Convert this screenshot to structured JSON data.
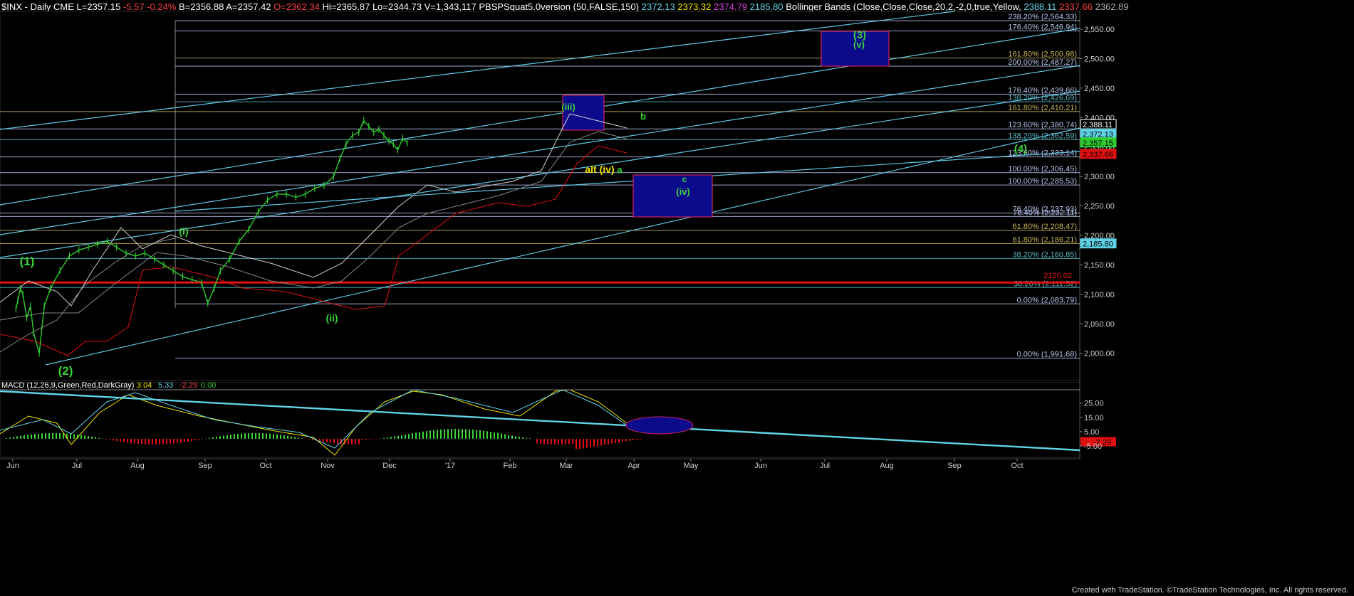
{
  "header": {
    "symbol": "$INX - Daily",
    "exchange": "CME",
    "last": "L=2357.15",
    "change": "-5.57",
    "change_pct": "-0.24%",
    "bid": "B=2356.88",
    "ask": "A=2357.42",
    "open": "O=2362.34",
    "high": "Hi=2365.87",
    "low": "Lo=2344.73",
    "volume": "V=1,343,117",
    "study": "PBSPSquat5.0version (50,FALSE,150)",
    "study_v1": "2372.13",
    "study_v2": "2373.32",
    "study_v3": "2374.79",
    "study_v4": "2185.80",
    "bb_label": "Bollinger Bands (Close,Close,Close,20,2,-2,0,true,Yellow,",
    "bb_v1": "2388.11",
    "bb_v2": "2337.66",
    "bb_v3": "2362.89"
  },
  "colors": {
    "background": "#000000",
    "price_bars": "#2ecc2e",
    "fib_blue": "#b8c6ee",
    "fib_olive": "#c9b458",
    "channel": "#5fc7e6",
    "red": "#e01010",
    "yellow": "#f2e600",
    "wave_green": "#3ad33a",
    "target_box": "#0b0b8c"
  },
  "footer": "Created with TradeStation. ©TradeStation Technologies, Inc. All rights reserved.",
  "chart_data": [
    {
      "type": "line",
      "title": "$INX - Daily",
      "ylim": [
        1975,
        2590
      ],
      "y_ticks": [
        "2,550.00",
        "2,500.00",
        "2,450.00",
        "2,400.00",
        "2,350.00",
        "2,300.00",
        "2,250.00",
        "2,200.00",
        "2,150.00",
        "2,100.00",
        "2,050.00",
        "2,000.00"
      ],
      "x_ticks": [
        "Jun",
        "Jul",
        "Aug",
        "Sep",
        "Oct",
        "Nov",
        "Dec",
        "'17",
        "Feb",
        "Mar",
        "Apr",
        "May",
        "Jun",
        "Jul",
        "Aug",
        "Sep",
        "Oct"
      ],
      "price_path": [
        [
          2016.05,
          2075
        ],
        [
          2016.08,
          2090
        ],
        [
          2016.12,
          2110
        ],
        [
          2016.16,
          2100
        ],
        [
          2016.22,
          2060
        ],
        [
          2016.28,
          2080
        ],
        [
          2016.33,
          2035
        ],
        [
          2016.42,
          2000
        ],
        [
          2016.5,
          2080
        ],
        [
          2016.6,
          2110
        ],
        [
          2016.75,
          2140
        ],
        [
          2016.9,
          2165
        ],
        [
          2017.05,
          2175
        ],
        [
          2017.2,
          2180
        ],
        [
          2017.35,
          2185
        ],
        [
          2017.5,
          2190
        ],
        [
          2017.65,
          2180
        ],
        [
          2017.8,
          2170
        ],
        [
          2017.95,
          2165
        ],
        [
          2018.1,
          2170
        ],
        [
          2018.25,
          2160
        ],
        [
          2018.4,
          2150
        ],
        [
          2018.55,
          2140
        ],
        [
          2018.7,
          2130
        ],
        [
          2018.85,
          2125
        ],
        [
          2019.0,
          2120
        ],
        [
          2019.1,
          2085
        ],
        [
          2019.2,
          2110
        ],
        [
          2019.3,
          2140
        ],
        [
          2019.45,
          2160
        ],
        [
          2019.6,
          2190
        ],
        [
          2019.75,
          2210
        ],
        [
          2019.9,
          2240
        ],
        [
          2020.05,
          2260
        ],
        [
          2020.2,
          2270
        ],
        [
          2020.35,
          2270
        ],
        [
          2020.5,
          2265
        ],
        [
          2020.65,
          2270
        ],
        [
          2020.8,
          2280
        ],
        [
          2020.95,
          2285
        ],
        [
          2021.1,
          2300
        ],
        [
          2021.2,
          2330
        ],
        [
          2021.3,
          2355
        ],
        [
          2021.4,
          2370
        ],
        [
          2021.5,
          2375
        ],
        [
          2021.58,
          2395
        ],
        [
          2021.66,
          2385
        ],
        [
          2021.74,
          2375
        ],
        [
          2021.82,
          2380
        ],
        [
          2021.9,
          2370
        ],
        [
          2021.98,
          2360
        ],
        [
          2022.05,
          2355
        ],
        [
          2022.12,
          2345
        ],
        [
          2022.2,
          2365
        ],
        [
          2022.27,
          2357
        ]
      ],
      "x_coord_legend": "months since Jun (Jun=0)",
      "fib_levels": [
        {
          "pct": "238.20%",
          "value": "2,564.33",
          "y": 2564.33,
          "color": "blue"
        },
        {
          "pct": "176.40%",
          "value": "2,546.94",
          "y": 2546.94,
          "color": "blue"
        },
        {
          "pct": "161.80%",
          "value": "2,500.98",
          "y": 2500.98,
          "color": "olive"
        },
        {
          "pct": "200.00%",
          "value": "2,487.27",
          "y": 2487.27,
          "color": "blue"
        },
        {
          "pct": "176.40%",
          "value": "2,439.66",
          "y": 2439.66,
          "color": "blue"
        },
        {
          "pct": "138.20%",
          "value": "2,426.69",
          "y": 2426.69,
          "color": "teal"
        },
        {
          "pct": "161.80%",
          "value": "2,410.21",
          "y": 2410.21,
          "color": "olive"
        },
        {
          "pct": "123.60%",
          "value": "2,380.74",
          "y": 2380.74,
          "color": "blue"
        },
        {
          "pct": "138.20%",
          "value": "2,362.59",
          "y": 2362.59,
          "color": "teal"
        },
        {
          "pct": "123.60%",
          "value": "2,333.14",
          "y": 2333.14,
          "color": "blue"
        },
        {
          "pct": "100.00%",
          "value": "2,306.45",
          "y": 2306.45,
          "color": "blue"
        },
        {
          "pct": "100.00%",
          "value": "2,285.53",
          "y": 2285.53,
          "color": "blue"
        },
        {
          "pct": "76.40%",
          "value": "2,237.93",
          "y": 2237.93,
          "color": "blue"
        },
        {
          "pct": "78.40%",
          "value": "2,232.11",
          "y": 2232.11,
          "color": "blue"
        },
        {
          "pct": "61.80%",
          "value": "2,208.47",
          "y": 2208.47,
          "color": "olive"
        },
        {
          "pct": "61.80%",
          "value": "2,186.21",
          "y": 2186.21,
          "color": "olive"
        },
        {
          "pct": "38.20%",
          "value": "2,160.85",
          "y": 2160.85,
          "color": "teal"
        },
        {
          "pct": "38.20%",
          "value": "2,111.52",
          "y": 2111.52,
          "color": "teal"
        },
        {
          "pct": "0.00%",
          "value": "2,083.79",
          "y": 2083.79,
          "color": "blue"
        },
        {
          "pct": "0.00%",
          "value": "1,991.68",
          "y": 1991.68,
          "color": "blue"
        }
      ],
      "red_line": {
        "value": "2120.02",
        "y": 2120.02
      },
      "price_tags": [
        {
          "value": "2,388.11",
          "y": 2388.11,
          "bg": "#000000",
          "fg": "#ffffff",
          "border": "#ffffff"
        },
        {
          "value": "2,372.13",
          "y": 2372.13,
          "bg": "#5fd3e6",
          "fg": "#000000",
          "border": "#5fd3e6"
        },
        {
          "value": "2,357.15",
          "y": 2357.15,
          "bg": "#2ecc2e",
          "fg": "#000000",
          "border": "#2ecc2e"
        },
        {
          "value": "2,337.66",
          "y": 2337.66,
          "bg": "#e01010",
          "fg": "#000000",
          "border": "#e01010"
        },
        {
          "value": "2,185.80",
          "y": 2185.8,
          "bg": "#5fd3e6",
          "fg": "#000000",
          "border": "#5fd3e6"
        }
      ],
      "wave_labels": [
        {
          "text": "(1)",
          "color": "green"
        },
        {
          "text": "(2)",
          "color": "green"
        },
        {
          "text": "(i)",
          "color": "green"
        },
        {
          "text": "(ii)",
          "color": "green"
        },
        {
          "text": "(iii)",
          "color": "green"
        },
        {
          "text": "b",
          "color": "green"
        },
        {
          "text": "alt (iv)",
          "color": "yellow"
        },
        {
          "text": "a",
          "color": "green"
        },
        {
          "text": "c",
          "color": "green"
        },
        {
          "text": "(iv)",
          "color": "green"
        },
        {
          "text": "(3)",
          "color": "green"
        },
        {
          "text": "(v)",
          "color": "green"
        },
        {
          "text": "(4)",
          "color": "green"
        }
      ]
    },
    {
      "type": "bar",
      "title": "MACD (12,26,9,Green,Red,DarkGray)",
      "values_text": [
        "3.04",
        "5.33",
        "-2.29",
        "0.00"
      ],
      "ylim": [
        -10,
        30
      ],
      "y_ticks": [
        "25.00",
        "15.00",
        "5.00",
        "-2.29",
        "-5.00"
      ]
    }
  ]
}
